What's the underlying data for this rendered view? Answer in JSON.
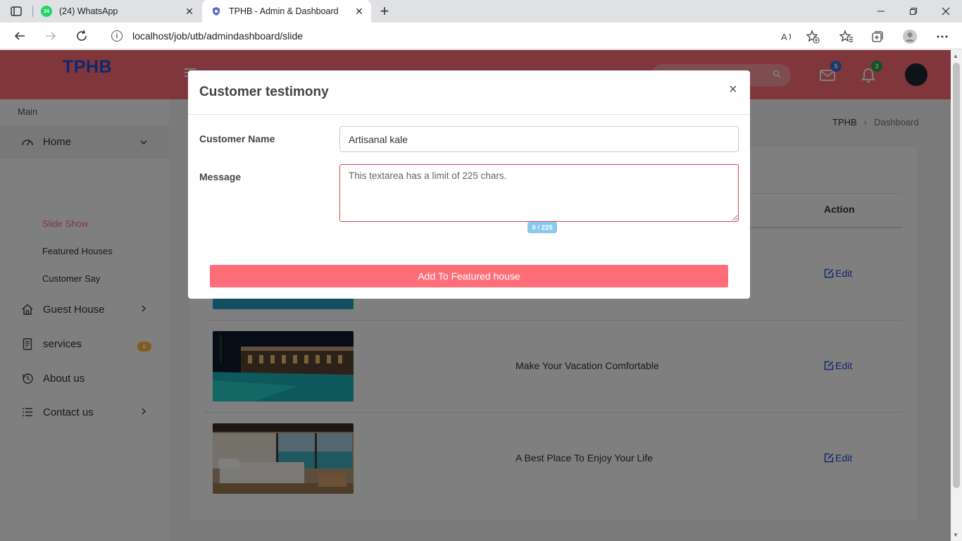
{
  "browser": {
    "tabs": [
      {
        "title": "(24) WhatsApp",
        "badge": "24",
        "icon": "whatsapp-icon",
        "close": "✕"
      },
      {
        "title": "TPHB - Admin & Dashboard",
        "icon": "shield-favicon-icon",
        "close": "✕"
      }
    ],
    "new_tab": "+",
    "url": "localhost/job/utb/admindashboard/slide"
  },
  "header": {
    "brand": "TPHB",
    "mail_badge": "5",
    "bell_badge": "3",
    "colors": {
      "bar": "#ff6e78",
      "brand": "#1e4fd8",
      "mail_badge": "#3b6fd8",
      "bell_badge": "#2ea44f"
    }
  },
  "sidebar": {
    "section": "Main",
    "home": "Home",
    "sub_items": [
      "Slide Show",
      "Featured Houses",
      "Customer Say"
    ],
    "guest_house": "Guest House",
    "services": "services",
    "services_badge": "6",
    "about": "About us",
    "contact": "Contact us"
  },
  "breadcrumb": {
    "root": "TPHB",
    "sep": "›",
    "current": "Dashboard"
  },
  "table": {
    "action_header": "Action",
    "rows": [
      {
        "text": "",
        "edit": "Edit"
      },
      {
        "text": "Make Your Vacation Comfortable",
        "edit": "Edit"
      },
      {
        "text": "A Best Place To Enjoy Your Life",
        "edit": "Edit"
      }
    ]
  },
  "modal": {
    "title": "Customer testimony",
    "close": "×",
    "name_label": "Customer Name",
    "name_value": "Artisanal kale",
    "message_label": "Message",
    "message_placeholder": "This textarea has a limit of 225 chars.",
    "counter": "0 / 225",
    "submit": "Add To Featured house"
  }
}
